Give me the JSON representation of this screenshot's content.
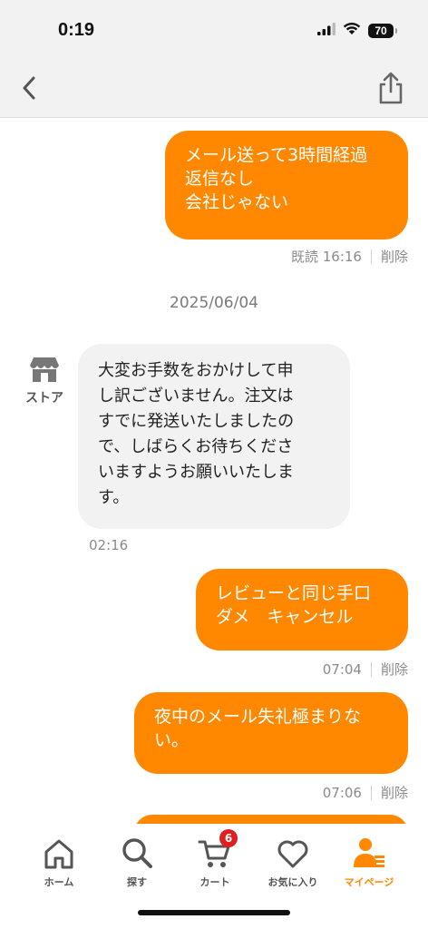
{
  "status_bar": {
    "time": "0:19",
    "battery": "70"
  },
  "messages": {
    "msg1": {
      "text": "メール送って3時間経過\n返信なし\n会社じゃない",
      "read_time": "既読 16:16",
      "delete": "削除"
    },
    "date": "2025/06/04",
    "store_label": "ストア",
    "store_msg": {
      "text": "大変お手数をおかけして申\nし訳ございません。注文は\nすでに発送いたしましたの\nで、しばらくお待ちくださ\nいますようお願いいたしま\nす。",
      "time": "02:16"
    },
    "msg2": {
      "text": "レビューと同じ手口\nダメ　キャンセル",
      "time": "07:04",
      "delete": "削除"
    },
    "msg3": {
      "text": "夜中のメール失礼極まりな\nい。",
      "time": "07:06",
      "delete": "削除"
    }
  },
  "tabs": {
    "home": "ホーム",
    "search": "探す",
    "cart": "カート",
    "cart_badge": "6",
    "favorites": "お気に入り",
    "mypage": "マイページ"
  },
  "colors": {
    "accent": "#ff8800",
    "bubble_in": "#f2f2f2",
    "badge": "#e02020"
  }
}
